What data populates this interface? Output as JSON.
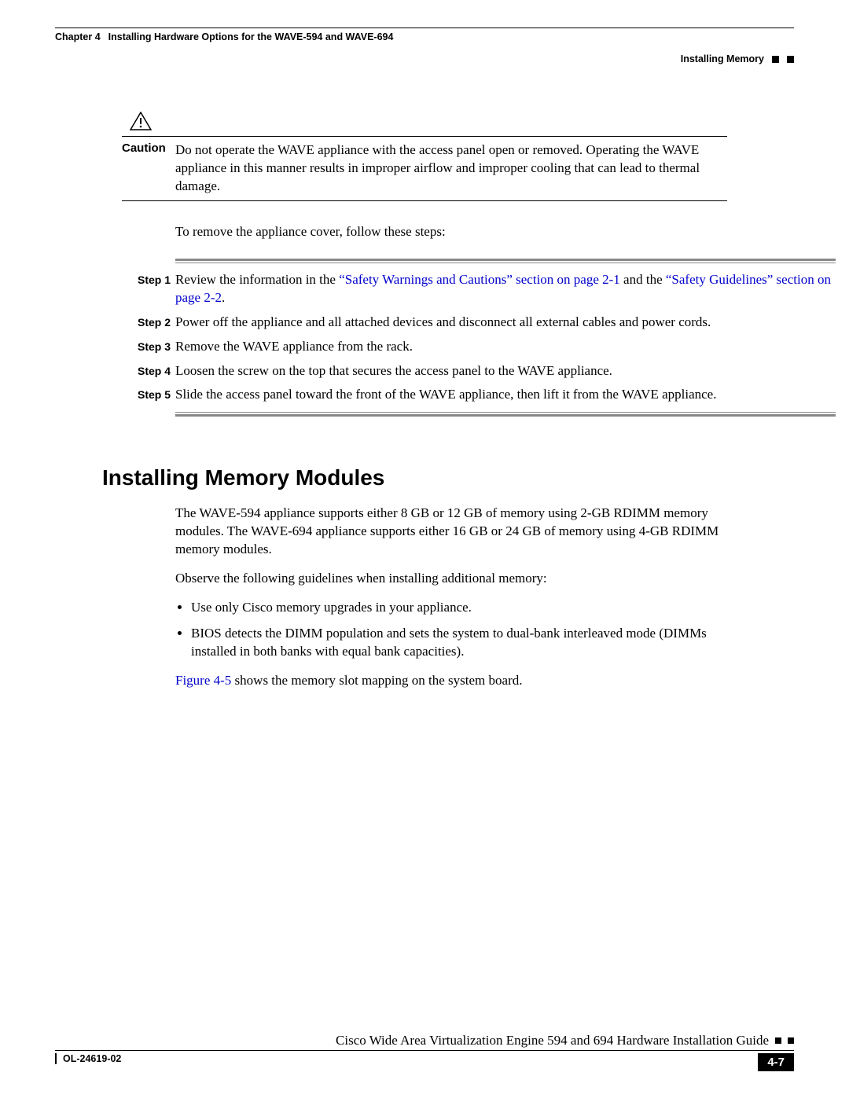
{
  "header": {
    "chapter_label": "Chapter 4",
    "chapter_title": "Installing Hardware Options for the WAVE-594 and WAVE-694",
    "section_title": "Installing Memory"
  },
  "caution": {
    "label": "Caution",
    "text": "Do not operate the WAVE appliance with the access panel open or removed. Operating the WAVE appliance in this manner results in improper airflow and improper cooling that can lead to thermal damage."
  },
  "intro": "To remove the appliance cover, follow these steps:",
  "steps": [
    {
      "label": "Step 1",
      "pre": "Review the information in the ",
      "link1": "“Safety Warnings and Cautions” section on page 2-1",
      "mid": " and the ",
      "link2": "“Safety Guidelines” section on page 2-2",
      "post": "."
    },
    {
      "label": "Step 2",
      "text": "Power off the appliance and all attached devices and disconnect all external cables and power cords."
    },
    {
      "label": "Step 3",
      "text": "Remove the WAVE appliance from the rack."
    },
    {
      "label": "Step 4",
      "text": "Loosen the screw on the top that secures the access panel to the WAVE appliance."
    },
    {
      "label": "Step 5",
      "text": "Slide the access panel toward the front of the WAVE appliance, then lift it from the WAVE appliance."
    }
  ],
  "section_heading": "Installing Memory Modules",
  "body": {
    "p1": "The WAVE-594 appliance supports either 8 GB or 12 GB of memory using 2-GB RDIMM memory modules. The WAVE-694 appliance supports either 16 GB or 24 GB of memory using 4-GB RDIMM memory modules.",
    "p2": "Observe the following guidelines when installing additional memory:",
    "b1": "Use only Cisco memory upgrades in your appliance.",
    "b2": "BIOS detects the DIMM population and sets the system to dual-bank interleaved mode (DIMMs installed in both banks with equal bank capacities).",
    "fig_link": "Figure 4-5",
    "fig_post": " shows the memory slot mapping on the system board."
  },
  "footer": {
    "guide": "Cisco Wide Area Virtualization Engine 594 and 694 Hardware Installation Guide",
    "doc": "OL-24619-02",
    "page": "4-7"
  }
}
